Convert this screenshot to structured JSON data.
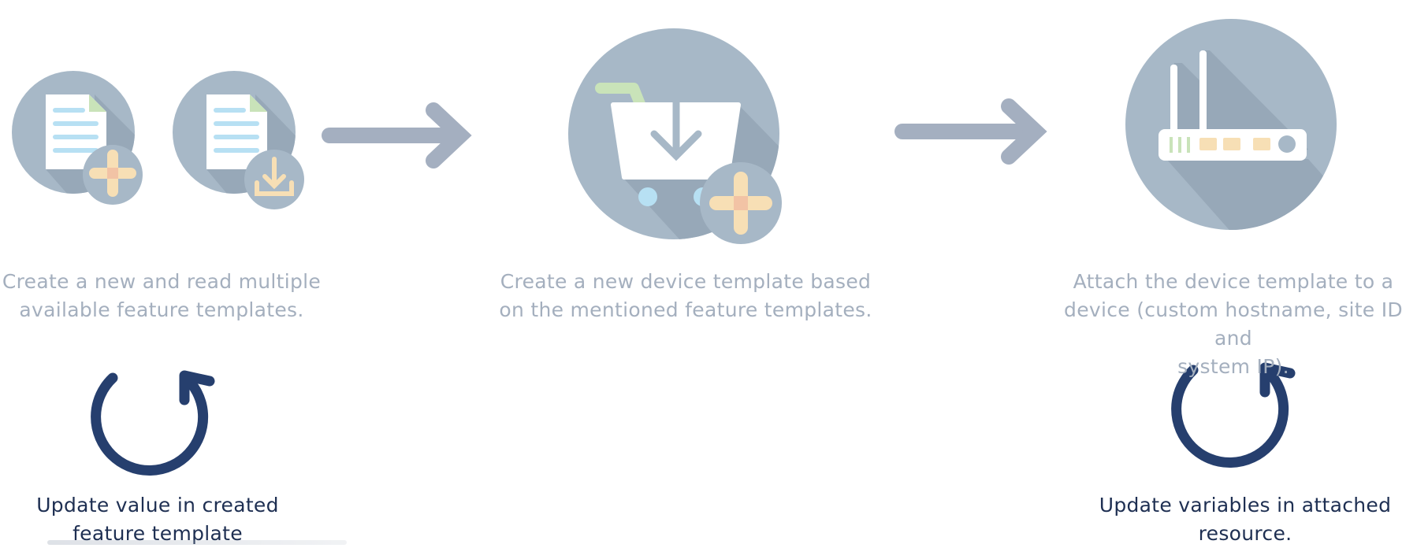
{
  "steps": [
    {
      "caption": [
        "Create a new and read multiple",
        "available feature templates."
      ],
      "icons": [
        "document-add-icon",
        "document-download-icon"
      ]
    },
    {
      "caption": [
        "Create a new device template based",
        "on the mentioned feature templates."
      ],
      "icons": [
        "cart-add-icon"
      ]
    },
    {
      "caption": [
        "Attach the device template to a",
        "device (custom hostname, site ID and",
        "system IP)."
      ],
      "icons": [
        "router-icon"
      ]
    }
  ],
  "updates": [
    {
      "text": [
        "Update value in created",
        "feature template"
      ],
      "icon": "refresh-icon"
    },
    {
      "text": [
        "Update variables in attached",
        "resource."
      ],
      "icon": "refresh-icon"
    }
  ],
  "colors": {
    "circle": "#a7b8c7",
    "shadow": "#97a8b8",
    "arrow": "#a4afc0",
    "doc": "#ffffff",
    "doc_lines": "#b7e0f3",
    "doc_fold": "#c9e3b9",
    "plus": "#f7dfb5",
    "plus_center": "#f2c3a5",
    "refresh": "#263f6e",
    "caption_text": "#a4afbe",
    "update_text": "#1e2f52"
  }
}
